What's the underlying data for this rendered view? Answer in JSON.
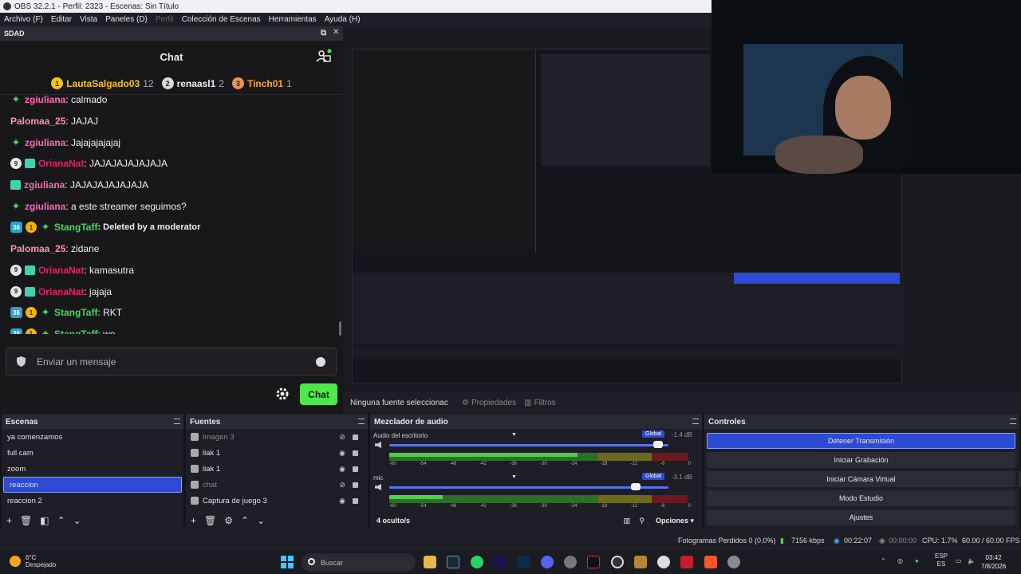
{
  "window": {
    "title": "OBS 32.2.1 - Perfil: 2323 - Escenas: Sin Título"
  },
  "menu": [
    {
      "label": "Archivo (F)",
      "enabled": true
    },
    {
      "label": "Editar",
      "enabled": true
    },
    {
      "label": "Vista",
      "enabled": true
    },
    {
      "label": "Paneles (D)",
      "enabled": true
    },
    {
      "label": "Perfil",
      "enabled": false
    },
    {
      "label": "Colección de Escenas",
      "enabled": true
    },
    {
      "label": "Herramientas",
      "enabled": true
    },
    {
      "label": "Ayuda (H)",
      "enabled": true
    }
  ],
  "chat_dock": {
    "dock_title": "SDAD",
    "title": "Chat",
    "leaderboard": [
      {
        "rank": "1",
        "name": "LautaSalgado03",
        "points": "12",
        "color": "#f5c518",
        "rank_bg": "#f5c518"
      },
      {
        "rank": "2",
        "name": "renaasl1",
        "points": "2",
        "color": "#efeff1",
        "rank_bg": "#d9d9d9"
      },
      {
        "rank": "3",
        "name": "Tinch01",
        "points": "1",
        "color": "#f5a623",
        "rank_bg": "#e8955a"
      }
    ],
    "messages": [
      {
        "badges": [
          "green"
        ],
        "user": "zgiuliana",
        "color": "#ff69b4",
        "text": ": calmado"
      },
      {
        "badges": [],
        "user": "Palomaa_25",
        "color": "#ff8fb5",
        "text": ": JAJAJ"
      },
      {
        "badges": [
          "green"
        ],
        "user": "zgiuliana",
        "color": "#ff69b4",
        "text": ": Jajajajajajaj"
      },
      {
        "badges": [
          "9",
          "teal"
        ],
        "user": "OrianaNat",
        "color": "#e0245e",
        "text": ": JAJAJAJAJAJAJA"
      },
      {
        "badges": [
          "teal"
        ],
        "user": "zgiuliana",
        "color": "#ff69b4",
        "text": ": JAJAJAJAJAJAJA"
      },
      {
        "badges": [
          "green"
        ],
        "user": "zgiuliana",
        "color": "#ff69b4",
        "text": ": a este streamer seguimos?"
      },
      {
        "badges": [
          "36",
          "1",
          "green"
        ],
        "user": "StangTaff",
        "color": "#43d95b",
        "text": ": Deleted by a moderator",
        "deleted": true
      },
      {
        "badges": [],
        "user": "Palomaa_25",
        "color": "#ff8fb5",
        "text": ": zidane"
      },
      {
        "badges": [
          "9",
          "teal"
        ],
        "user": "OrianaNat",
        "color": "#e0245e",
        "text": ": kamasutra"
      },
      {
        "badges": [
          "9",
          "teal"
        ],
        "user": "OrianaNat",
        "color": "#e0245e",
        "text": ": jajaja"
      },
      {
        "badges": [
          "36",
          "1",
          "green"
        ],
        "user": "StangTaff",
        "color": "#43d95b",
        "text": ": RKT"
      },
      {
        "badges": [
          "36",
          "1",
          "green"
        ],
        "user": "StangTaff",
        "color": "#43d95b",
        "text": ": we"
      }
    ],
    "input_placeholder": "Enviar un mensaje",
    "send_label": "Chat",
    "send_color": "#4ee84a"
  },
  "source_bar": {
    "no_selection": "Ninguna fuente seleccionac",
    "properties": "Propiedades",
    "filters": "Filtros"
  },
  "scenes": {
    "title": "Escenas",
    "items": [
      {
        "label": "ya comenzamos",
        "selected": false
      },
      {
        "label": "full cam",
        "selected": false
      },
      {
        "label": "zoom",
        "selected": false
      },
      {
        "label": "reaccion",
        "selected": true
      },
      {
        "label": "reaccion 2",
        "selected": false
      }
    ]
  },
  "sources": {
    "title": "Fuentes",
    "items": [
      {
        "label": "Imagen 3",
        "dim": true
      },
      {
        "label": "liak 1",
        "dim": false
      },
      {
        "label": "liak 1",
        "dim": false
      },
      {
        "label": "chat",
        "dim": true
      },
      {
        "label": "Captura de juego 3",
        "dim": false
      }
    ]
  },
  "mixer": {
    "title": "Mezclador de audio",
    "channels": [
      {
        "name": "Audio del escritorio",
        "global": "Global",
        "db": "-1.4 dB",
        "volume": 0.98,
        "level": 0.63
      },
      {
        "name": "mic",
        "global": "Global",
        "db": "-3.1 dB",
        "volume": 0.9,
        "level": 0.18
      }
    ],
    "ticks": [
      "-60",
      "-54",
      "-48",
      "-42",
      "-36",
      "-30",
      "-24",
      "-18",
      "-12",
      "-6",
      "0"
    ],
    "hidden": "4 oculto/s",
    "options": "Opciones"
  },
  "controls": {
    "title": "Controles",
    "buttons": [
      {
        "label": "Detener Transmisión",
        "active": true
      },
      {
        "label": "Iniciar Grabación",
        "active": false
      },
      {
        "label": "Iniciar Cámara Virtual",
        "active": false
      },
      {
        "label": "Modo Estudio",
        "active": false
      },
      {
        "label": "Ajustes",
        "active": false
      }
    ]
  },
  "status": {
    "dropped": "Fotogramas Perdidos 0 (0.0%)",
    "bitrate": "7156 kbps",
    "live_time": "00:22:07",
    "rec_time": "00:00:00",
    "cpu": "CPU: 1.7%",
    "fps": "60.00 / 60.00 FPS"
  },
  "taskbar": {
    "temp": "6°C",
    "weather": "Despejado",
    "search": "Buscar",
    "lang1": "ESP",
    "lang2": "ES",
    "time": "03:42",
    "date": "7/8/2026"
  }
}
